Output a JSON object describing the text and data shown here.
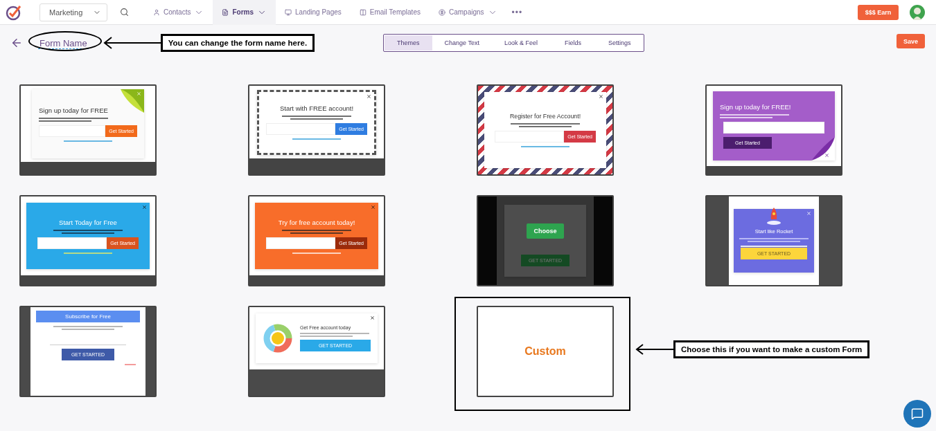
{
  "nav": {
    "workspace": "Marketing",
    "items": [
      {
        "label": "Contacts",
        "dropdown": true,
        "selected": false
      },
      {
        "label": "Forms",
        "dropdown": true,
        "selected": true
      },
      {
        "label": "Landing Pages",
        "dropdown": false,
        "selected": false
      },
      {
        "label": "Email Templates",
        "dropdown": false,
        "selected": false
      },
      {
        "label": "Campaigns",
        "dropdown": true,
        "selected": false
      }
    ],
    "more": "•••",
    "earn": "$$$ Earn"
  },
  "toolbar": {
    "form_name": "Form Name",
    "form_name_note": "You can change the form name here.",
    "tabs": [
      {
        "label": "Themes",
        "selected": true
      },
      {
        "label": "Change Text",
        "selected": false
      },
      {
        "label": "Look & Feel",
        "selected": false
      },
      {
        "label": "Fields",
        "selected": false
      },
      {
        "label": "Settings",
        "selected": false
      }
    ],
    "save": "Save"
  },
  "templates": [
    {
      "kind": "corner",
      "title": "Sign up today for FREE",
      "button": "Get Started",
      "hovered": false
    },
    {
      "kind": "dashed",
      "title": "Start with FREE account!",
      "button": "Get Started",
      "hovered": false
    },
    {
      "kind": "airmail",
      "title": "Register for Free Account!",
      "button": "Get Started",
      "hovered": false
    },
    {
      "kind": "purple",
      "title": "Sign up today for FREE!",
      "button": "Get Started",
      "hovered": false
    },
    {
      "kind": "blue",
      "title": "Start Today for Free",
      "button": "Get Started",
      "hovered": false
    },
    {
      "kind": "orange",
      "title": "Try for free account today!",
      "button": "Get Started",
      "hovered": false
    },
    {
      "kind": "dark",
      "button": "GET STARTED",
      "hovered": true,
      "choose": "Choose"
    },
    {
      "kind": "rocket",
      "title": "Start like Rocket",
      "button": "GET STARTED",
      "hovered": false
    },
    {
      "kind": "subscribe",
      "title": "Subscribe for Free",
      "button": "GET STARTED",
      "hovered": false
    },
    {
      "kind": "chart",
      "title": "Get Free account today",
      "button": "GET STARTED",
      "hovered": false
    },
    {
      "kind": "custom",
      "title": "Custom",
      "note": "Choose this if you want to make a custom Form",
      "hovered": false
    }
  ]
}
